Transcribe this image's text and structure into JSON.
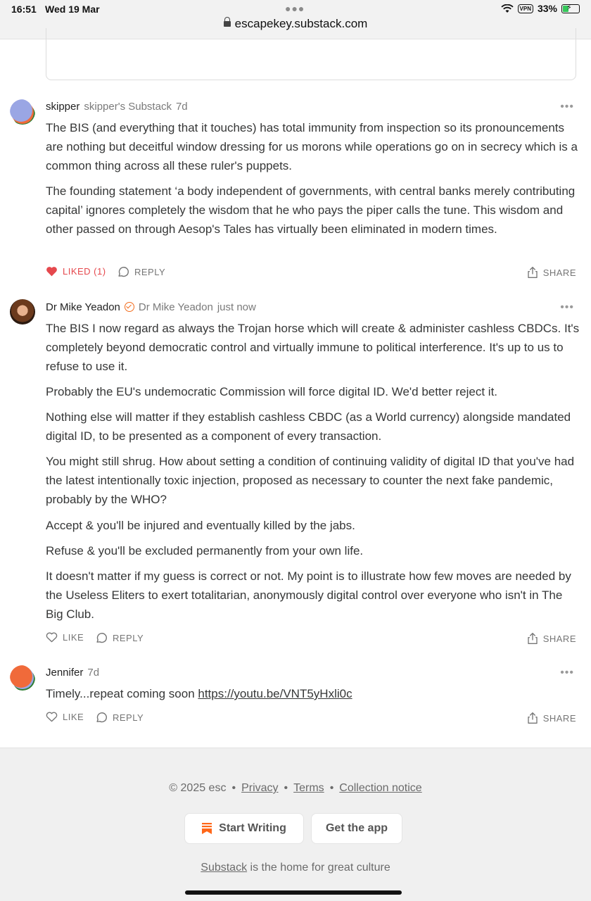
{
  "status_bar": {
    "time": "16:51",
    "date": "Wed 19 Mar",
    "vpn": "VPN",
    "battery": "33%"
  },
  "browser": {
    "url": "escapekey.substack.com"
  },
  "comments": [
    {
      "author": "skipper",
      "publication": "skipper's Substack",
      "time": "7d",
      "paragraphs": [
        "The BIS (and everything that it touches) has total immunity from inspection so its pronouncements are nothing but deceitful window dressing for us morons while operations go on in secrecy which is a common thing across all these ruler's puppets.",
        "The founding statement ‘a body independent of governments, with central banks merely contributing capital’ ignores completely the wisdom that he who pays the piper calls the tune. This wisdom and other passed on through Aesop's Tales has virtually been eliminated in modern times."
      ],
      "like_label": "LIKED (1)",
      "reply_label": "REPLY",
      "share_label": "SHARE"
    },
    {
      "author": "Dr Mike Yeadon",
      "publication": "Dr Mike Yeadon",
      "time": "just now",
      "paragraphs": [
        "The BIS I now regard as always the Trojan horse which will create & administer cashless CBDCs. It's completely beyond democratic control and virtually immune to political interference. It's up to us to refuse to use it.",
        "Probably the EU's undemocratic Commission will force digital ID. We'd better reject it.",
        "Nothing else will matter if they establish cashless CBDC (as a World currency) alongside mandated digital ID, to be presented as a component of every transaction.",
        "You might still shrug. How about setting a condition of continuing validity of digital ID that you've had the latest intentionally toxic injection, proposed as necessary to counter the next fake pandemic, probably by the WHO?",
        "Accept & you'll be injured and eventually killed by the jabs.",
        "Refuse & you'll be excluded permanently from your own life.",
        "It doesn't matter if my guess is correct or not. My point is to illustrate how few moves are needed by the Useless Eliters to exert totalitarian, anonymously digital control over everyone who isn't in The Big Club."
      ],
      "like_label": "LIKE",
      "reply_label": "REPLY",
      "share_label": "SHARE"
    },
    {
      "author": "Jennifer",
      "time": "7d",
      "text": "Timely...repeat coming soon ",
      "link": "https://youtu.be/VNT5yHxli0c",
      "like_label": "LIKE",
      "reply_label": "REPLY",
      "share_label": "SHARE"
    }
  ],
  "footer": {
    "copyright": "© 2025 esc",
    "links": [
      "Privacy",
      "Terms",
      "Collection notice"
    ],
    "start_writing": "Start Writing",
    "get_app": "Get the app",
    "tagline_link": "Substack",
    "tagline_rest": " is the home for great culture"
  },
  "colors": {
    "liked": "#e5484d",
    "substack_orange": "#ff6719",
    "footer_bg": "#f0f0f0"
  }
}
